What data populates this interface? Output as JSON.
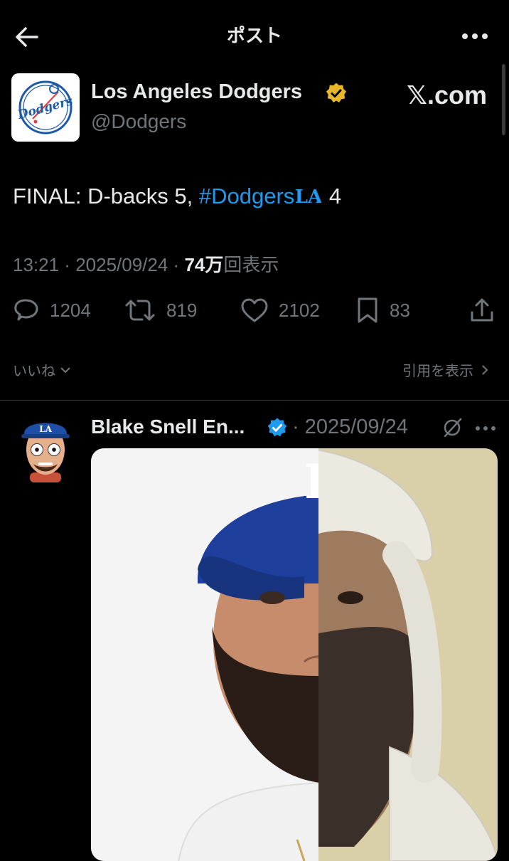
{
  "header": {
    "title": "ポスト"
  },
  "author": {
    "name": "Los Angeles Dodgers",
    "handle": "@Dodgers",
    "avatar_text": "Dodgers"
  },
  "watermark": "𝕏.com",
  "tweet": {
    "text_prefix": "FINAL: D-backs 5, ",
    "hashtag": "#Dodgers",
    "text_suffix": " 4"
  },
  "meta": {
    "time": "13:21",
    "date": "2025/09/24",
    "views_count": "74万",
    "views_label": "回表示"
  },
  "stats": {
    "replies": "1204",
    "reposts": "819",
    "likes": "2102",
    "bookmarks": "83"
  },
  "engagement": {
    "likes_label": "いいね",
    "quotes_label": "引用を表示"
  },
  "reply": {
    "name": "Blake Snell En...",
    "date": "2025/09/24"
  },
  "colors": {
    "accent": "#1d9bf0",
    "muted": "#71767b",
    "text": "#e7e9ea",
    "verified_gold": "#e8b829"
  }
}
